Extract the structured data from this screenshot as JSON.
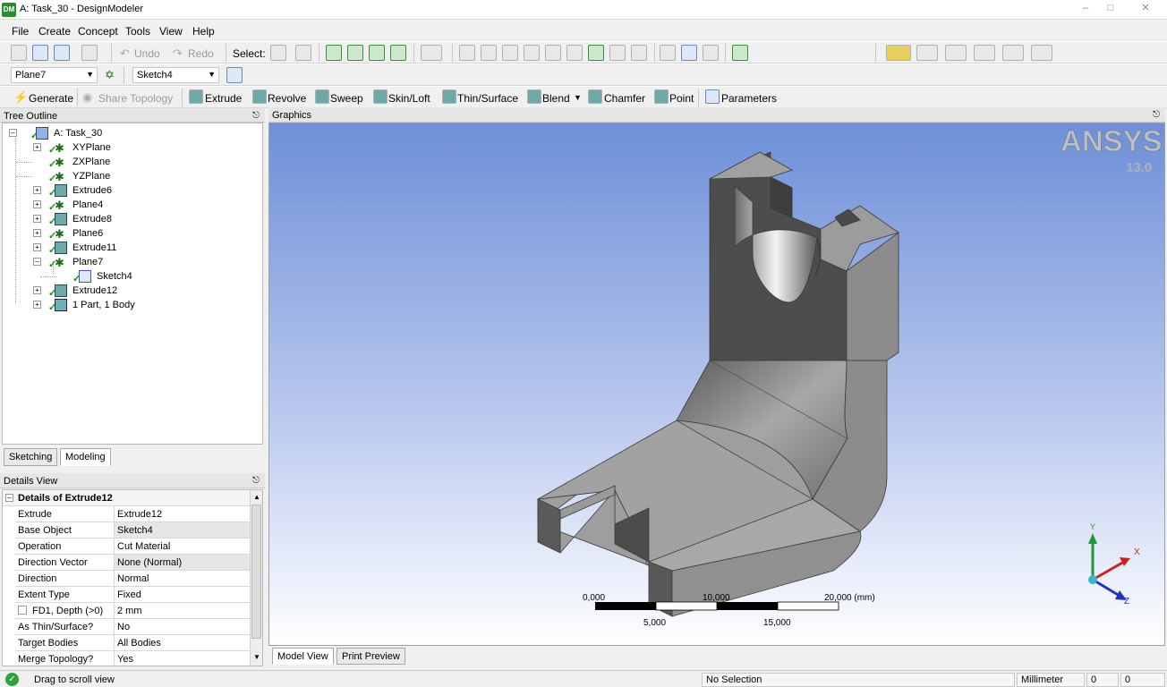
{
  "window": {
    "title": "A: Task_30 - DesignModeler",
    "app_icon": "DM"
  },
  "menu": [
    "File",
    "Create",
    "Concept",
    "Tools",
    "View",
    "Help"
  ],
  "toolbar1": {
    "undo": "Undo",
    "redo": "Redo",
    "select_label": "Select:"
  },
  "toolbar2": {
    "plane": "Plane7",
    "sketch": "Sketch4"
  },
  "toolbar3": {
    "generate": "Generate",
    "share_topology": "Share Topology",
    "extrude": "Extrude",
    "revolve": "Revolve",
    "sweep": "Sweep",
    "skin_loft": "Skin/Loft",
    "thin_surface": "Thin/Surface",
    "blend": "Blend",
    "chamfer": "Chamfer",
    "point": "Point",
    "parameters": "Parameters"
  },
  "tree_outline": {
    "header": "Tree Outline",
    "root": "A: Task_30",
    "nodes": [
      "XYPlane",
      "ZXPlane",
      "YZPlane",
      "Extrude6",
      "Plane4",
      "Extrude8",
      "Plane6",
      "Extrude11",
      "Plane7",
      "Sketch4",
      "Extrude12",
      "1 Part, 1 Body"
    ]
  },
  "tabs": {
    "sketching": "Sketching",
    "modeling": "Modeling"
  },
  "details": {
    "header": "Details View",
    "group": "Details of Extrude12",
    "rows": [
      {
        "key": "Extrude",
        "value": "Extrude12"
      },
      {
        "key": "Base Object",
        "value": "Sketch4"
      },
      {
        "key": "Operation",
        "value": "Cut Material"
      },
      {
        "key": "Direction Vector",
        "value": "None (Normal)"
      },
      {
        "key": "Direction",
        "value": "Normal"
      },
      {
        "key": "Extent Type",
        "value": "Fixed"
      },
      {
        "key": "FD1, Depth (>0)",
        "value": "2 mm"
      },
      {
        "key": "As Thin/Surface?",
        "value": "No"
      },
      {
        "key": "Target Bodies",
        "value": "All Bodies"
      },
      {
        "key": "Merge Topology?",
        "value": "Yes"
      }
    ]
  },
  "graphics": {
    "header": "Graphics",
    "brand": "ANSYS",
    "version": "13.0",
    "scale_top": [
      "0,000",
      "10,000",
      "20,000 (mm)"
    ],
    "scale_bottom": [
      "5,000",
      "15,000"
    ],
    "axes": {
      "x": "X",
      "y": "Y",
      "z": "Z"
    },
    "colors": {
      "bg_top": "#6e8fd8",
      "bg_bottom": "#ffffff",
      "part": "#9a9a9a"
    }
  },
  "view_tabs": {
    "model": "Model View",
    "print": "Print Preview"
  },
  "status": {
    "message": "Drag to scroll view",
    "selection": "No Selection",
    "units": "Millimeter",
    "v1": "0",
    "v2": "0"
  }
}
